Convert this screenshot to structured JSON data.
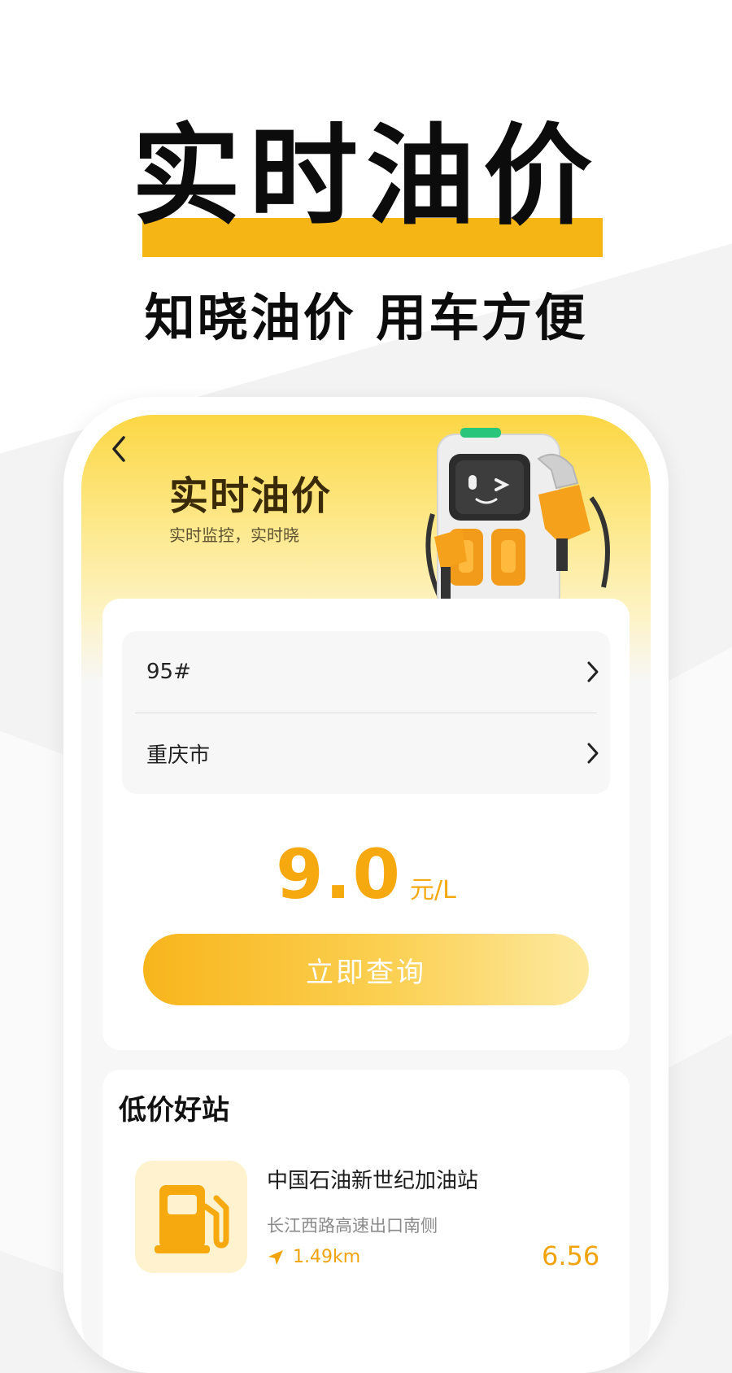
{
  "hero": {
    "title": "实时油价",
    "subtitle": "知晓油价 用车方便"
  },
  "screen": {
    "title": "实时油价",
    "subtitle": "实时监控，实时晓",
    "back_icon": "chevron-left-icon",
    "illustration": "fuel-pump-mascot"
  },
  "query": {
    "fuel_type": "95#",
    "city": "重庆市",
    "price_value": "9.0",
    "price_unit": "元/L",
    "button_label": "立即查询"
  },
  "stations": {
    "section_title": "低价好站",
    "items": [
      {
        "name": "中国石油新世纪加油站",
        "address": "长江西路高速出口南侧",
        "distance": "1.49km",
        "price": "6.56",
        "icon": "fuel-pump-icon"
      }
    ]
  },
  "colors": {
    "accent": "#f6a80f",
    "underline": "#f5b514",
    "header_gradient_top": "#fcd744",
    "card_bg": "#ffffff"
  }
}
